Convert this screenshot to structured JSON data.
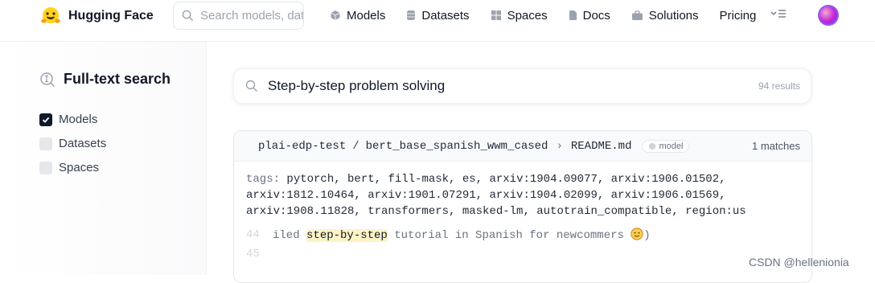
{
  "header": {
    "brand": "Hugging Face",
    "search_placeholder": "Search models, datasets, users...",
    "nav": [
      {
        "label": "Models",
        "icon": "cube-icon"
      },
      {
        "label": "Datasets",
        "icon": "database-icon"
      },
      {
        "label": "Spaces",
        "icon": "grid-icon"
      },
      {
        "label": "Docs",
        "icon": "docs-icon"
      },
      {
        "label": "Solutions",
        "icon": "briefcase-icon"
      },
      {
        "label": "Pricing"
      }
    ],
    "more_icon": "menu-more-icon"
  },
  "sidebar": {
    "title": "Full-text search",
    "filters": [
      {
        "label": "Models",
        "checked": true
      },
      {
        "label": "Datasets",
        "checked": false
      },
      {
        "label": "Spaces",
        "checked": false
      }
    ]
  },
  "search": {
    "query": "Step-by-step problem solving",
    "results_count": "94 results"
  },
  "result": {
    "owner": "plai-edp-test",
    "slash": "/",
    "repo": "bert_base_spanish_wwm_cased",
    "chevron": "›",
    "file": "README.md",
    "badge": "model",
    "matches": "1 matches",
    "tags_key": "tags:",
    "tags_line1": " pytorch, bert, fill-mask, es, arxiv:1904.09077, arxiv:1906.01502,",
    "tags_line2": "arxiv:1812.10464, arxiv:1901.07291, arxiv:1904.02099, arxiv:1906.01569,",
    "tags_line3": "arxiv:1908.11828, transformers, masked-lm, autotrain_compatible, region:us",
    "lines": [
      {
        "num": "44",
        "pre": "iled ",
        "highlight": "step-by-step",
        "post": " tutorial in Spanish for newcommers ",
        "tail": ")"
      },
      {
        "num": "45"
      }
    ]
  },
  "watermark": "CSDN @hellenionia",
  "colors": {
    "highlight": "#fef3c7",
    "accent_logo": "#ffd21e"
  }
}
